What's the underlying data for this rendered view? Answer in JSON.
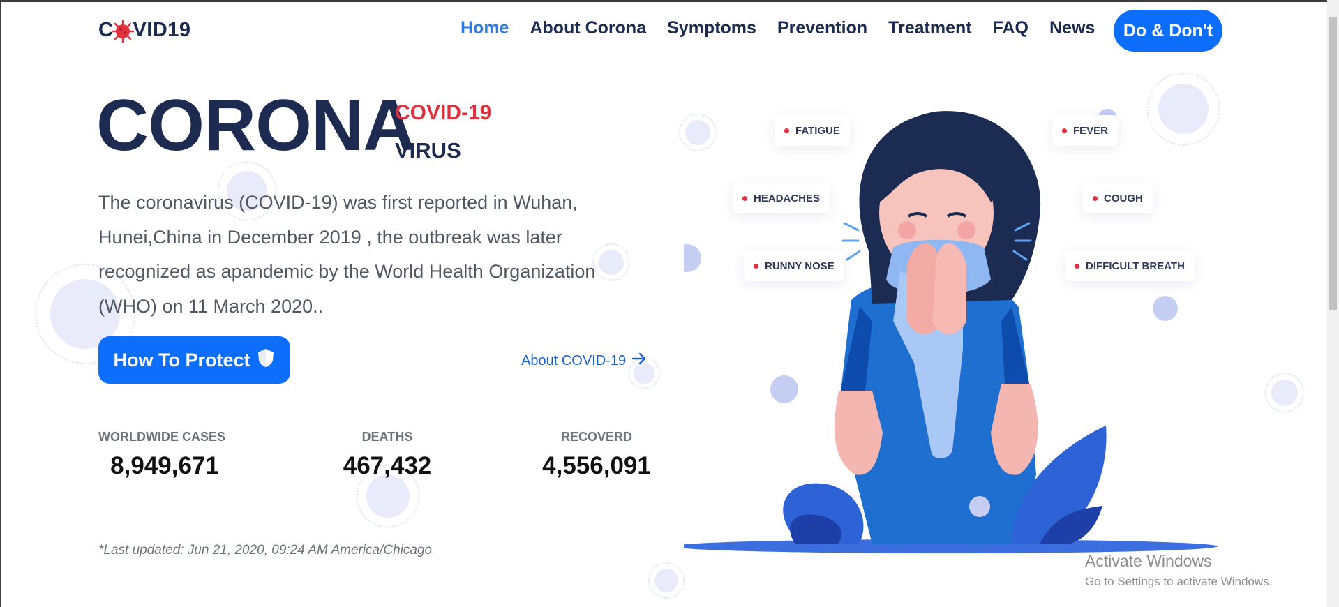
{
  "nav": {
    "logo_text_prefix": "C",
    "logo_text_suffix": "VID19",
    "links": [
      "Home",
      "About Corona",
      "Symptoms",
      "Prevention",
      "Treatment",
      "FAQ",
      "News"
    ],
    "active_link": "Home",
    "cta_label": "Do & Don't"
  },
  "hero": {
    "title": "CORONA",
    "tag_top": "COVID-19",
    "tag_bottom": "VIRUS",
    "description": "The coronavirus (COVID-19) was first reported in Wuhan, Hunei,China in December 2019 , the outbreak was later recognized as apandemic by the World Health Organization (WHO) on 11 March 2020..",
    "protect_button": "How To Protect",
    "about_link": "About COVID-19"
  },
  "stats": [
    {
      "label": "WORLDWIDE CASES",
      "value": "8,949,671"
    },
    {
      "label": "DEATHS",
      "value": "467,432"
    },
    {
      "label": "RECOVERD",
      "value": "4,556,091"
    }
  ],
  "last_updated": "*Last updated: Jun 21, 2020, 09:24 AM America/Chicago",
  "symptoms": {
    "fatigue": "FATIGUE",
    "fever": "FEVER",
    "headaches": "HEADACHES",
    "cough": "COUGH",
    "runny_nose": "RUNNY NOSE",
    "difficult_breath": "DIFFICULT BREATH"
  },
  "windows_watermark": {
    "line1": "Activate Windows",
    "line2": "Go to Settings to activate Windows."
  },
  "colors": {
    "primary": "#0d6efd",
    "navy": "#1c2b4f",
    "accent_red": "#e0313e",
    "active_link": "#2c7be5"
  },
  "icons": [
    "virus-logo-icon",
    "shield-icon",
    "arrow-right-icon"
  ]
}
